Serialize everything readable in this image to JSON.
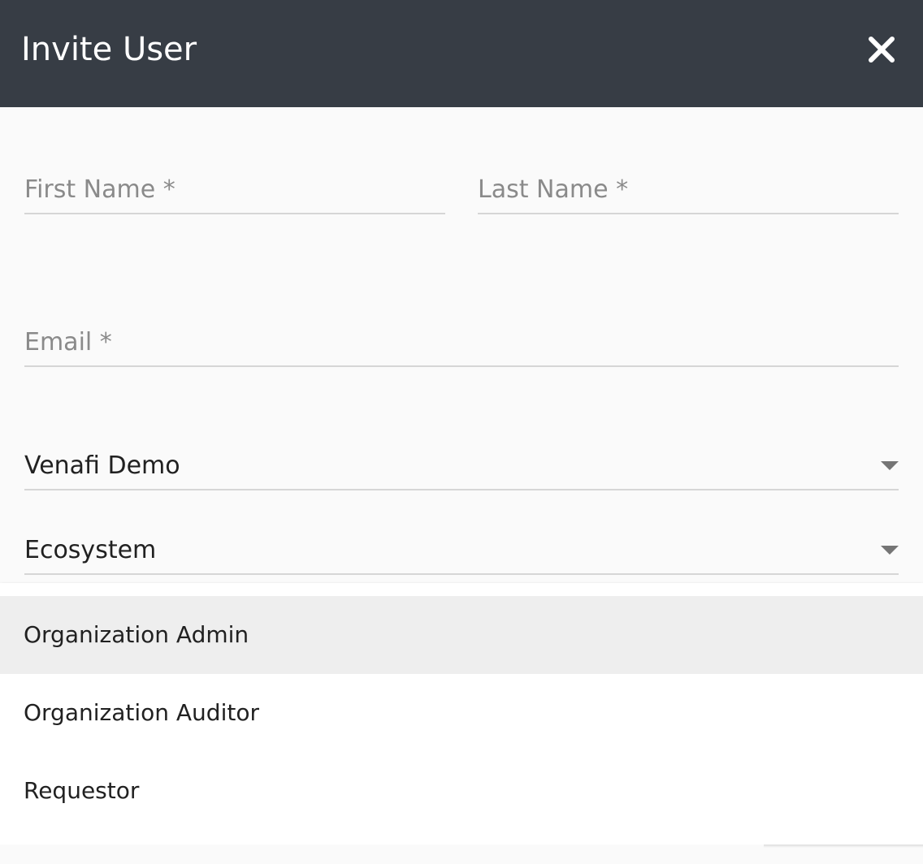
{
  "dialog": {
    "title": "Invite User",
    "close_icon": "close-icon"
  },
  "form": {
    "first_name": {
      "label": "First Name *",
      "value": ""
    },
    "last_name": {
      "label": "Last Name *",
      "value": ""
    },
    "email": {
      "label": "Email *",
      "value": ""
    },
    "organization": {
      "selected": "Venafi Demo",
      "icon": "chevron-down-icon"
    },
    "role_type": {
      "selected": "Ecosystem",
      "icon": "chevron-down-icon"
    }
  },
  "dropdown": {
    "items": [
      {
        "label": "Organization Admin",
        "highlighted": true
      },
      {
        "label": "Organization Auditor",
        "highlighted": false
      },
      {
        "label": "Requestor",
        "highlighted": false
      }
    ]
  },
  "colors": {
    "header_bg": "#373d45",
    "body_bg": "#fafafa",
    "highlight_bg": "#eeeeee"
  }
}
